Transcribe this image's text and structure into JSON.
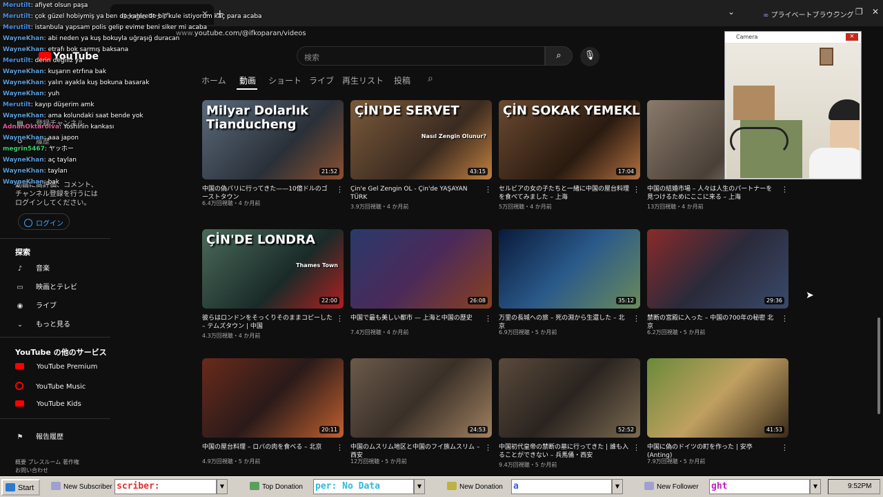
{
  "browser": {
    "tab_title": "Google マップ",
    "private_label": "プライベートブラウジング",
    "url_dim": "www.",
    "url": "youtube.com/@ifkoparan/videos"
  },
  "youtube": {
    "logo": "YouTube",
    "search_placeholder": "検索",
    "channel_tabs": [
      "ホーム",
      "動画",
      "ショート",
      "ライブ",
      "再生リスト",
      "投稿"
    ],
    "sidebar": {
      "subscriptions_label": "登録チャンネル",
      "history_label": "履歴",
      "login_prompt": "動画に高評価、コメント、チャンネル登録を行うにはログインしてください。",
      "login_button": "ログイン",
      "explore_heading": "探索",
      "explore_items": [
        "音楽",
        "映画とテレビ",
        "ライブ",
        "もっと見る"
      ],
      "services_heading": "YouTube の他のサービス",
      "services_items": [
        "YouTube Premium",
        "YouTube Music",
        "YouTube Kids"
      ],
      "report_history": "報告履歴",
      "footer": [
        "概要  プレスルーム  著作権",
        "お問い合わせ"
      ]
    },
    "videos": [
      {
        "overlay": "Milyar Dolarlık\nTianducheng",
        "duration": "21:52",
        "title": "中国の偽パリに行ってきた——10億ドルのゴーストタウン",
        "meta": "6.4万回視聴・4 か月前",
        "bg": "linear-gradient(135deg,#5a6a7a,#2a3038 60%,#8a5030)"
      },
      {
        "overlay": "ÇİN'DE SERVET",
        "overlay2": "Nasıl Zengin Olunur?",
        "duration": "43:15",
        "title": "Çin'e Gel Zengin OL - Çin'de YAŞAYAN TÜRK",
        "meta": "3.9万回視聴・4 か月前",
        "bg": "linear-gradient(135deg,#7a5a3a,#3a2a20 60%,#c08040)"
      },
      {
        "overlay": "ÇİN SOKAK YEMEKLERİ",
        "duration": "17:04",
        "title": "セルビアの女の子たちと一緒に中国の屋台料理を食べてみました – 上海",
        "meta": "5万回視聴・4 か月前",
        "bg": "linear-gradient(135deg,#6a4a30,#2a1a10 60%,#b07040)"
      },
      {
        "overlay": "",
        "duration": "",
        "title": "中国の結婚市場 – 人々は人生のパートナーを見つけるためにここに来る – 上海",
        "meta": "13万回視聴・4 か月前",
        "bg": "linear-gradient(135deg,#8a7a6a,#4a4038 60%,#b0a090)"
      },
      {
        "overlay": "ÇİN'DE LONDRA",
        "overlay2": "Thames Town",
        "duration": "22:00",
        "title": "彼らはロンドンをそっくりそのままコピーした – テムズタウン | 中国",
        "meta": "4.3万回視聴・4 か月前",
        "bg": "linear-gradient(135deg,#4a6a5a,#1a2a28 60%,#b02020)"
      },
      {
        "overlay": "",
        "duration": "26:08",
        "title": "中国で最も美しい都市 — 上海と中国の歴史",
        "meta": "7.4万回視聴・4 か月前",
        "bg": "linear-gradient(135deg,#2a3a6a,#4a2a5a 50%,#8a4020)"
      },
      {
        "overlay": "",
        "duration": "35:12",
        "title": "万里の長城への旅 – 死の淵から生還した – 北京",
        "meta": "6.9万回視聴・5 か月前",
        "bg": "linear-gradient(135deg,#0a1a3a,#2a5a8a 50%,#6a8a5a)"
      },
      {
        "overlay": "",
        "duration": "29:36",
        "title": "禁断の宮殿に入った – 中国の700年の秘密 北京",
        "meta": "6.2万回視聴・5 か月前",
        "bg": "linear-gradient(135deg,#8a2a2a,#2a2a3a 50%,#3a4a6a)"
      },
      {
        "overlay": "",
        "duration": "20:11",
        "title": "中国の屋台料理 – ロバの肉を食べる – 北京",
        "meta": "4.9万回視聴・5 か月前",
        "bg": "linear-gradient(135deg,#6a2a1a,#2a1a1a 50%,#c06030)"
      },
      {
        "overlay": "",
        "duration": "24:53",
        "title": "中国のムスリム地区と中国のフイ族ムスリム – 西安",
        "meta": "12万回視聴・5 か月前",
        "bg": "linear-gradient(135deg,#6a5a4a,#3a3028 50%,#a08060)"
      },
      {
        "overlay": "",
        "duration": "52:52",
        "title": "中国初代皇帝の禁断の墓に行ってきた | 誰も入ることができない – 兵馬俑・西安",
        "meta": "9.4万回視聴・5 か月前",
        "bg": "linear-gradient(135deg,#5a4a3a,#2a2420 50%,#7a6a50)"
      },
      {
        "overlay": "",
        "duration": "41:53",
        "title": "中国に偽のドイツの町を作った | 安亭 (Anting)",
        "meta": "7.9万回視聴・5 か月前",
        "bg": "linear-gradient(135deg,#6a8a3a,#c0a060 50%,#3a2a1a)"
      }
    ]
  },
  "chat": [
    {
      "name": "Merutilt",
      "color": "#4a90e2",
      "text": "afiyet olsun paşa"
    },
    {
      "name": "Merutilt",
      "color": "#4a90e2",
      "text": "çok güzel hobiymiş ya ben de kahirede bir kule istiyorum kaç para acaba"
    },
    {
      "name": "Merutilt",
      "color": "#4a90e2",
      "text": "istanbula yapsam polis gelip evime beni siker mi acaba"
    },
    {
      "name": "WayneKhan",
      "color": "#5b9bd5",
      "text": "abi neden ya kuş bokuyla uğraşığ duracan"
    },
    {
      "name": "WayneKhan",
      "color": "#5b9bd5",
      "text": "etrafı bok sarmış baksana"
    },
    {
      "name": "Merutilt",
      "color": "#4a90e2",
      "text": "derin değiliz ya"
    },
    {
      "name": "WayneKhan",
      "color": "#5b9bd5",
      "text": "kuşarın etrfına bak"
    },
    {
      "name": "WayneKhan",
      "color": "#5b9bd5",
      "text": "yalın ayakla kuş bokuna basarak"
    },
    {
      "name": "WayneKhan",
      "color": "#5b9bd5",
      "text": "yuh"
    },
    {
      "name": "Merutilt",
      "color": "#4a90e2",
      "text": "kayıp düşerim amk"
    },
    {
      "name": "WayneKhan",
      "color": "#5b9bd5",
      "text": "ama kolundaki saat bende yok"
    },
    {
      "name": "AdnanOktarolva",
      "color": "#e05a9a",
      "text": "Yoshinin kankası"
    },
    {
      "name": "WayneKhan",
      "color": "#5b9bd5",
      "text": "aaa japon"
    },
    {
      "name": "megrin5467",
      "color": "#3cd06a",
      "text": "ヤッホー"
    },
    {
      "name": "WayneKhan",
      "color": "#5b9bd5",
      "text": "aç taylan"
    },
    {
      "name": "WayneKhan",
      "color": "#5b9bd5",
      "text": "taylan"
    },
    {
      "name": "WayneKhan",
      "color": "#5b9bd5",
      "text": "bak"
    }
  ],
  "camera": {
    "title": "Camera"
  },
  "taskbar": {
    "start": "Start",
    "new_subscriber": "New Subscriber",
    "subscriber_box": "scriber:",
    "top_donation": "Top Donation",
    "top_donation_box": "per: No Data",
    "new_donation": "New Donation",
    "new_donation_box": "a",
    "new_follower": "New Follower",
    "new_follower_box": "ght",
    "clock": "9:52PM"
  }
}
